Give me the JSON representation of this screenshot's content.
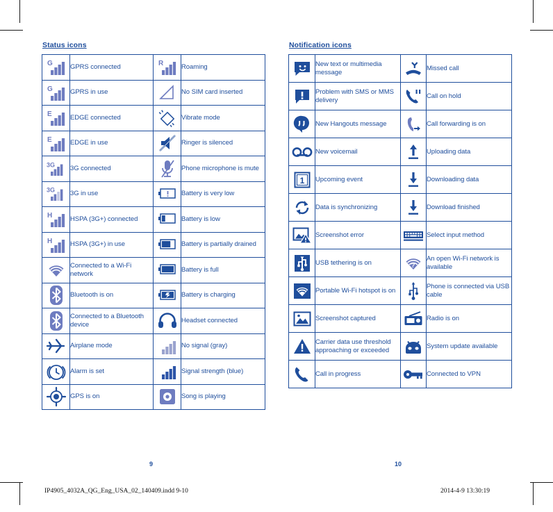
{
  "document": {
    "status_heading": "Status icons",
    "notification_heading": "Notification icons",
    "left_page_number": "9",
    "right_page_number": "10",
    "footer_filename": "IP4905_4032A_QG_Eng_USA_02_140409.indd   9-10",
    "footer_timestamp": "2014-4-9   13:30:19"
  },
  "colors": {
    "ink_blue": "#1F4E9C",
    "icon_blue": "#1F4E9C",
    "icon_light_blue": "#6E7CC0",
    "crop_mark": "#1a1a1a",
    "page_background": "#ffffff"
  },
  "status_icons": {
    "heading": "Status icons",
    "rows": [
      {
        "left": {
          "icon": "signal-gprs-connected-icon",
          "label": "GPRS connected"
        },
        "right": {
          "icon": "signal-roaming-icon",
          "label": "Roaming"
        }
      },
      {
        "left": {
          "icon": "signal-gprs-in-use-icon",
          "label": "GPRS in use"
        },
        "right": {
          "icon": "no-sim-card-icon",
          "label": "No SIM card inserted"
        }
      },
      {
        "left": {
          "icon": "signal-edge-connected-icon",
          "label": "EDGE connected"
        },
        "right": {
          "icon": "vibrate-mode-icon",
          "label": "Vibrate mode"
        }
      },
      {
        "left": {
          "icon": "signal-edge-in-use-icon",
          "label": "EDGE in use"
        },
        "right": {
          "icon": "ringer-silenced-icon",
          "label": "Ringer is silenced"
        }
      },
      {
        "left": {
          "icon": "signal-3g-connected-icon",
          "label": "3G connected"
        },
        "right": {
          "icon": "microphone-mute-icon",
          "label": "Phone microphone is mute"
        }
      },
      {
        "left": {
          "icon": "signal-3g-in-use-icon",
          "label": "3G in use"
        },
        "right": {
          "icon": "battery-very-low-icon",
          "label": "Battery is very low"
        }
      },
      {
        "left": {
          "icon": "signal-hspa-connected-icon",
          "label": "HSPA (3G+) connected"
        },
        "right": {
          "icon": "battery-low-icon",
          "label": "Battery is low"
        }
      },
      {
        "left": {
          "icon": "signal-hspa-in-use-icon",
          "label": "HSPA (3G+) in use"
        },
        "right": {
          "icon": "battery-partially-drained-icon",
          "label": "Battery is partially drained"
        }
      },
      {
        "left": {
          "icon": "wifi-connected-icon",
          "label": "Connected to a Wi-Fi network"
        },
        "right": {
          "icon": "battery-full-icon",
          "label": "Battery is full"
        }
      },
      {
        "left": {
          "icon": "bluetooth-on-icon",
          "label": "Bluetooth is on"
        },
        "right": {
          "icon": "battery-charging-icon",
          "label": "Battery is charging"
        }
      },
      {
        "left": {
          "icon": "bluetooth-connected-icon",
          "label": "Connected to a Bluetooth device"
        },
        "right": {
          "icon": "headset-connected-icon",
          "label": "Headset connected"
        }
      },
      {
        "left": {
          "icon": "airplane-mode-icon",
          "label": "Airplane mode"
        },
        "right": {
          "icon": "no-signal-gray-icon",
          "label": "No signal (gray)"
        }
      },
      {
        "left": {
          "icon": "alarm-set-icon",
          "label": "Alarm is set"
        },
        "right": {
          "icon": "signal-strength-blue-icon",
          "label": "Signal strength (blue)"
        }
      },
      {
        "left": {
          "icon": "gps-on-icon",
          "label": "GPS is on"
        },
        "right": {
          "icon": "song-playing-icon",
          "label": "Song is playing"
        }
      }
    ]
  },
  "notification_icons": {
    "heading": "Notification icons",
    "rows": [
      {
        "left": {
          "icon": "new-message-icon",
          "label": "New text or multimedia message"
        },
        "right": {
          "icon": "missed-call-icon",
          "label": "Missed call"
        }
      },
      {
        "left": {
          "icon": "sms-problem-icon",
          "label": "Problem with SMS or MMS delivery"
        },
        "right": {
          "icon": "call-on-hold-icon",
          "label": "Call on hold"
        }
      },
      {
        "left": {
          "icon": "hangouts-message-icon",
          "label": "New Hangouts message"
        },
        "right": {
          "icon": "call-forwarding-icon",
          "label": "Call forwarding is on"
        }
      },
      {
        "left": {
          "icon": "voicemail-icon",
          "label": "New voicemail"
        },
        "right": {
          "icon": "uploading-data-icon",
          "label": "Uploading data"
        }
      },
      {
        "left": {
          "icon": "upcoming-event-icon",
          "label": "Upcoming event"
        },
        "right": {
          "icon": "downloading-data-icon",
          "label": "Downloading data"
        }
      },
      {
        "left": {
          "icon": "data-sync-icon",
          "label": "Data is synchronizing"
        },
        "right": {
          "icon": "download-finished-icon",
          "label": "Download finished"
        }
      },
      {
        "left": {
          "icon": "screenshot-error-icon",
          "label": "Screenshot error"
        },
        "right": {
          "icon": "select-input-method-icon",
          "label": "Select input method"
        }
      },
      {
        "left": {
          "icon": "usb-tethering-icon",
          "label": "USB tethering is on"
        },
        "right": {
          "icon": "open-wifi-available-icon",
          "label": "An open Wi-Fi network is available"
        }
      },
      {
        "left": {
          "icon": "portable-wifi-hotspot-icon",
          "label": "Portable Wi-Fi hotspot is on"
        },
        "right": {
          "icon": "usb-cable-connected-icon",
          "label": "Phone is connected via USB cable"
        }
      },
      {
        "left": {
          "icon": "screenshot-captured-icon",
          "label": "Screenshot captured"
        },
        "right": {
          "icon": "radio-on-icon",
          "label": "Radio is on"
        }
      },
      {
        "left": {
          "icon": "carrier-data-warning-icon",
          "label": "Carrier data use threshold approaching or exceeded"
        },
        "right": {
          "icon": "system-update-icon",
          "label": "System update available"
        }
      },
      {
        "left": {
          "icon": "call-in-progress-icon",
          "label": "Call in progress"
        },
        "right": {
          "icon": "vpn-connected-icon",
          "label": "Connected to VPN"
        }
      }
    ]
  }
}
